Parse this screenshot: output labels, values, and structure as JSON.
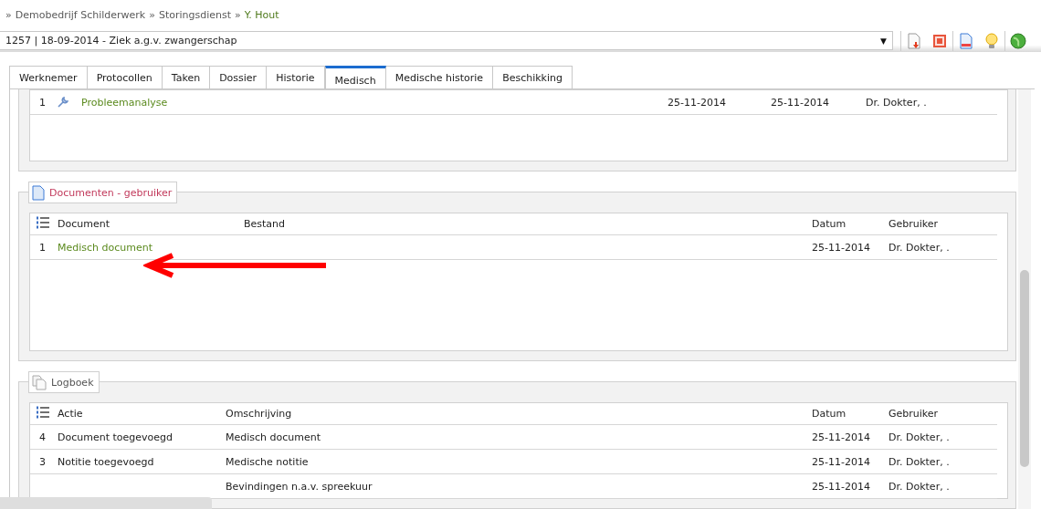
{
  "breadcrumb": [
    {
      "separator": "»",
      "label": "Demobedrijf Schilderwerk",
      "current": false
    },
    {
      "separator": "»",
      "label": "Storingsdienst",
      "current": false
    },
    {
      "separator": "»",
      "label": "Y. Hout",
      "current": true
    }
  ],
  "case_select": {
    "value": "1257 | 18-09-2014 - Ziek a.g.v. zwangerschap",
    "caret": "▼"
  },
  "toolbar": [
    {
      "kind": "upload"
    },
    {
      "kind": "slides"
    },
    {
      "kind": "document"
    },
    {
      "kind": "idea"
    },
    {
      "kind": "globe"
    }
  ],
  "tabs": [
    {
      "label": "Werknemer",
      "selected": false
    },
    {
      "label": "Protocollen",
      "selected": false
    },
    {
      "label": "Taken",
      "selected": false
    },
    {
      "label": "Dossier",
      "selected": false
    },
    {
      "label": "Historie",
      "selected": false
    },
    {
      "label": "Medisch",
      "selected": true
    },
    {
      "label": "Medische historie",
      "selected": false
    },
    {
      "label": "Beschikking",
      "selected": false
    }
  ],
  "tasks": {
    "rows": [
      {
        "number": "1",
        "name": "Probleemanalyse",
        "date_1": "25-11-2014",
        "date_2": "25-11-2014",
        "user": "Dr. Dokter, ."
      }
    ]
  },
  "documents": {
    "title": "Documenten - gebruiker",
    "columns": [
      "Document",
      "Bestand",
      "Datum",
      "Gebruiker"
    ],
    "rows": [
      {
        "number": "1",
        "document": "Medisch document",
        "date": "25-11-2014",
        "user": "Dr. Dokter, ."
      }
    ]
  },
  "log": {
    "title": "Logboek",
    "columns": [
      "Actie",
      "Omschrijving",
      "Datum",
      "Gebruiker"
    ],
    "rows": [
      {
        "number": "4",
        "action": "Document toegevoegd",
        "description": "Medisch document",
        "date": "25-11-2014",
        "user": "Dr. Dokter, ."
      },
      {
        "number": "3",
        "action": "Notitie toegevoegd",
        "description": "Medische notitie",
        "date": "25-11-2014",
        "user": "Dr. Dokter, ."
      },
      {
        "description": "Bevindingen n.a.v. spreekuur",
        "date": "25-11-2014",
        "user": "Dr. Dokter, ."
      }
    ]
  }
}
